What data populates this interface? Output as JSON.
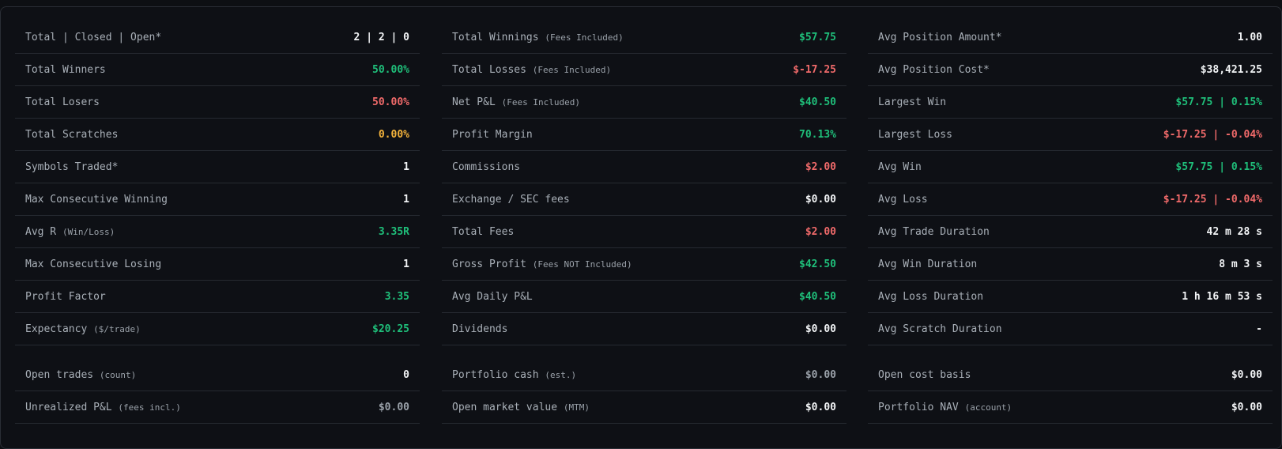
{
  "colors": {
    "green": "#1fbf7a",
    "red": "#f06a6a",
    "amber": "#f5b43c",
    "white": "#f2f4f6",
    "muted": "#9aa1a9"
  },
  "col1": {
    "rows": [
      {
        "label": "Total | Closed | Open*",
        "note": "",
        "value": "2 | 2 | 0"
      },
      {
        "label": "Total Winners",
        "note": "",
        "value": "50.00%"
      },
      {
        "label": "Total Losers",
        "note": "",
        "value": "50.00%"
      },
      {
        "label": "Total Scratches",
        "note": "",
        "value": "0.00%"
      },
      {
        "label": "Symbols Traded*",
        "note": "",
        "value": "1"
      },
      {
        "label": "Max Consecutive Winning",
        "note": "",
        "value": "1"
      },
      {
        "label": "Avg R",
        "note": "(Win/Loss)",
        "value": "3.35R"
      },
      {
        "label": "Max Consecutive Losing",
        "note": "",
        "value": "1"
      },
      {
        "label": "Profit Factor",
        "note": "",
        "value": "3.35"
      },
      {
        "label": "Expectancy",
        "note": "($/trade)",
        "value": "$20.25"
      }
    ],
    "open": [
      {
        "label": "Open trades",
        "note": "(count)",
        "value": "0"
      },
      {
        "label": "Unrealized P&L",
        "note": "(fees incl.)",
        "value": "$0.00"
      }
    ]
  },
  "col2": {
    "rows": [
      {
        "label": "Total Winnings",
        "note": "(Fees Included)",
        "value": "$57.75"
      },
      {
        "label": "Total Losses",
        "note": "(Fees Included)",
        "value": "$-17.25"
      },
      {
        "label": "Net P&L",
        "note": "(Fees Included)",
        "value": "$40.50"
      },
      {
        "label": "Profit Margin",
        "note": "",
        "value": "70.13%"
      },
      {
        "label": "Commissions",
        "note": "",
        "value": "$2.00"
      },
      {
        "label": "Exchange / SEC fees",
        "note": "",
        "value": "$0.00"
      },
      {
        "label": "Total Fees",
        "note": "",
        "value": "$2.00"
      },
      {
        "label": "Gross Profit",
        "note": "(Fees NOT Included)",
        "value": "$42.50"
      },
      {
        "label": "Avg Daily P&L",
        "note": "",
        "value": "$40.50"
      },
      {
        "label": "Dividends",
        "note": "",
        "value": "$0.00"
      }
    ],
    "open": [
      {
        "label": "Portfolio cash",
        "note": "(est.)",
        "value": "$0.00"
      },
      {
        "label": "Open market value",
        "note": "(MTM)",
        "value": "$0.00"
      }
    ]
  },
  "col3": {
    "rows": [
      {
        "label": "Avg Position Amount*",
        "note": "",
        "value": "1.00"
      },
      {
        "label": "Avg Position Cost*",
        "note": "",
        "value": "$38,421.25"
      },
      {
        "label": "Largest Win",
        "note": "",
        "value": "$57.75 | 0.15%"
      },
      {
        "label": "Largest Loss",
        "note": "",
        "value": "$-17.25 | -0.04%"
      },
      {
        "label": "Avg Win",
        "note": "",
        "value": "$57.75 | 0.15%"
      },
      {
        "label": "Avg Loss",
        "note": "",
        "value": "$-17.25 | -0.04%"
      },
      {
        "label": "Avg Trade Duration",
        "note": "",
        "value": "42 m 28 s"
      },
      {
        "label": "Avg Win Duration",
        "note": "",
        "value": "8 m 3 s"
      },
      {
        "label": "Avg Loss Duration",
        "note": "",
        "value": "1 h 16 m 53 s"
      },
      {
        "label": "Avg Scratch Duration",
        "note": "",
        "value": "-"
      }
    ],
    "open": [
      {
        "label": "Open cost basis",
        "note": "",
        "value": "$0.00"
      },
      {
        "label": "Portfolio NAV",
        "note": "(account)",
        "value": "$0.00"
      }
    ]
  }
}
